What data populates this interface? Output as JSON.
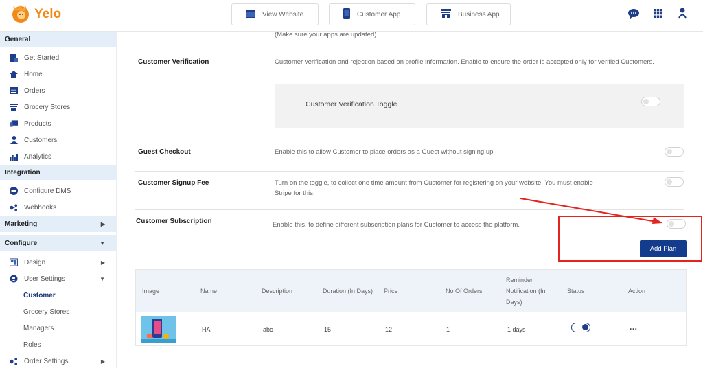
{
  "app": {
    "logo_text": "Yelo"
  },
  "top_buttons": [
    {
      "label": "View Website",
      "icon": "website-icon"
    },
    {
      "label": "Customer App",
      "icon": "phone-icon"
    },
    {
      "label": "Business App",
      "icon": "store-icon"
    }
  ],
  "top_right_icons": [
    "chat-icon",
    "apps-grid-icon",
    "user-icon"
  ],
  "sidebar": {
    "general_label": "General",
    "general_items": [
      "Get Started",
      "Home",
      "Orders",
      "Grocery Stores",
      "Products",
      "Customers",
      "Analytics"
    ],
    "integration_label": "Integration",
    "integration_items": [
      "Configure DMS",
      "Webhooks"
    ],
    "marketing_label": "Marketing",
    "configure_label": "Configure",
    "configure_items": [
      "Design",
      "User Settings"
    ],
    "user_settings_sub": [
      "Customer",
      "Grocery Stores",
      "Managers",
      "Roles"
    ],
    "order_settings": "Order Settings"
  },
  "main": {
    "top_note": "(Make sure your apps are updated).",
    "verification": {
      "label": "Customer Verification",
      "desc": "Customer verification and rejection based on profile information. Enable to ensure the order is accepted only for verified Customers.",
      "toggle_label": "Customer Verification Toggle",
      "enabled": false
    },
    "guest": {
      "label": "Guest Checkout",
      "desc": "Enable this to allow Customer to place orders as a Guest without signing up",
      "enabled": false
    },
    "signup": {
      "label": "Customer Signup Fee",
      "desc": "Turn on the toggle, to collect one time amount from Customer for registering on your website. You must enable Stripe for this.",
      "enabled": false
    },
    "subscription": {
      "label": "Customer Subscription",
      "desc": "Enable this, to define different subscription plans for Customer to access the platform.",
      "enabled": false,
      "add_button": "Add Plan"
    },
    "table": {
      "headers": [
        "Image",
        "Name",
        "Description",
        "Duration (In Days)",
        "Price",
        "No Of Orders",
        "Reminder Notification (In Days)",
        "Status",
        "Action"
      ],
      "rows": [
        {
          "name": "HA",
          "description": "abc",
          "duration": "15",
          "price": "12",
          "orders": "1",
          "reminder": "1 days",
          "status": true,
          "action": "..."
        }
      ]
    }
  },
  "colors": {
    "accent": "#143c8c",
    "highlight": "#e4251f",
    "section_bg": "#e3eef8",
    "logo": "#f28a1a"
  }
}
